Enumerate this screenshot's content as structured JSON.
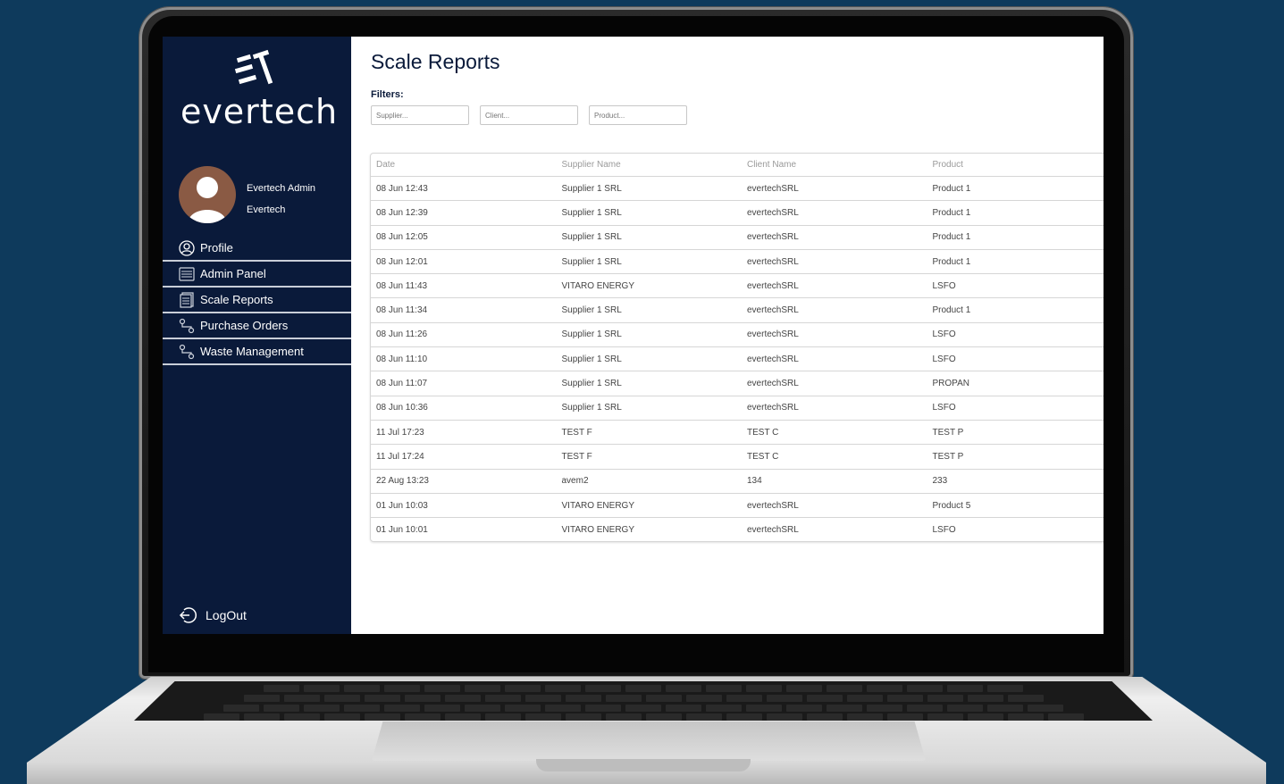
{
  "app": {
    "brand": "evertech",
    "page_title": "Scale Reports"
  },
  "user": {
    "name": "Evertech Admin",
    "org": "Evertech"
  },
  "nav": {
    "items": [
      {
        "label": "Profile",
        "icon": "user-circle-icon"
      },
      {
        "label": "Admin Panel",
        "icon": "admin-panel-icon"
      },
      {
        "label": "Scale Reports",
        "icon": "report-icon"
      },
      {
        "label": "Purchase Orders",
        "icon": "route-icon"
      },
      {
        "label": "Waste Management",
        "icon": "route-icon"
      }
    ],
    "logout_label": "LogOut"
  },
  "filters": {
    "label": "Filters:",
    "supplier_placeholder": "Supplier...",
    "client_placeholder": "Client...",
    "product_placeholder": "Product..."
  },
  "table": {
    "columns": [
      "Date",
      "Supplier Name",
      "Client Name",
      "Product"
    ],
    "rows": [
      [
        "08 Jun 12:43",
        "Supplier 1 SRL",
        "evertechSRL",
        "Product 1"
      ],
      [
        "08 Jun 12:39",
        "Supplier 1 SRL",
        "evertechSRL",
        "Product 1"
      ],
      [
        "08 Jun 12:05",
        "Supplier 1 SRL",
        "evertechSRL",
        "Product 1"
      ],
      [
        "08 Jun 12:01",
        "Supplier 1 SRL",
        "evertechSRL",
        "Product 1"
      ],
      [
        "08 Jun 11:43",
        "VITARO ENERGY",
        "evertechSRL",
        "LSFO"
      ],
      [
        "08 Jun 11:34",
        "Supplier 1 SRL",
        "evertechSRL",
        "Product 1"
      ],
      [
        "08 Jun 11:26",
        "Supplier 1 SRL",
        "evertechSRL",
        "LSFO"
      ],
      [
        "08 Jun 11:10",
        "Supplier 1 SRL",
        "evertechSRL",
        "LSFO"
      ],
      [
        "08 Jun 11:07",
        "Supplier 1 SRL",
        "evertechSRL",
        "PROPAN"
      ],
      [
        "08 Jun 10:36",
        "Supplier 1 SRL",
        "evertechSRL",
        "LSFO"
      ],
      [
        "11 Jul 17:23",
        "TEST F",
        "TEST C",
        "TEST P"
      ],
      [
        "11 Jul 17:24",
        "TEST F",
        "TEST C",
        "TEST P"
      ],
      [
        "22 Aug 13:23",
        "avem2",
        "134",
        "233"
      ],
      [
        "01 Jun 10:03",
        "VITARO ENERGY",
        "evertechSRL",
        "Product 5"
      ],
      [
        "01 Jun 10:01",
        "VITARO ENERGY",
        "evertechSRL",
        "LSFO"
      ]
    ]
  },
  "colors": {
    "background": "#0e3a5c",
    "sidebar": "#0a1a3a",
    "title": "#0a1a3a"
  }
}
